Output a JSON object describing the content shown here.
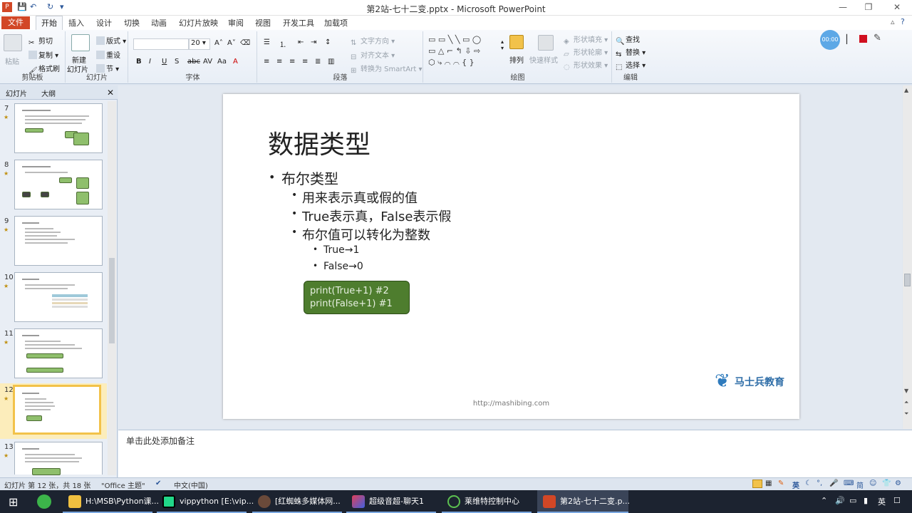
{
  "window": {
    "title": "第2站-七十二变.pptx - Microsoft PowerPoint",
    "controls": [
      "minimize",
      "restore",
      "close"
    ]
  },
  "tabs": {
    "file": "文件",
    "items": [
      "开始",
      "插入",
      "设计",
      "切换",
      "动画",
      "幻灯片放映",
      "审阅",
      "视图",
      "开发工具",
      "加载项"
    ]
  },
  "ribbon": {
    "clipboard": {
      "label": "剪贴板",
      "paste": "粘贴",
      "cut": "剪切",
      "copy": "复制",
      "format_painter": "格式刷"
    },
    "slides": {
      "label": "幻灯片",
      "new_slide_1": "新建",
      "new_slide_2": "幻灯片",
      "layout": "版式",
      "reset": "重设",
      "section": "节"
    },
    "font": {
      "label": "字体",
      "size": "20"
    },
    "paragraph": {
      "label": "段落",
      "text_direction": "文字方向",
      "align_text": "对齐文本",
      "smartart": "转换为 SmartArt"
    },
    "drawing": {
      "label": "绘图",
      "arrange": "排列",
      "quick_styles": "快速样式",
      "fill": "形状填充",
      "outline": "形状轮廓",
      "effects": "形状效果"
    },
    "editing": {
      "label": "编辑",
      "find": "查找",
      "replace": "替换",
      "select": "选择"
    }
  },
  "recorder": {
    "time": "00:00"
  },
  "left_pane": {
    "tabs": [
      "幻灯片",
      "大纲"
    ],
    "thumbnails": [
      {
        "num": "7"
      },
      {
        "num": "8"
      },
      {
        "num": "9"
      },
      {
        "num": "10"
      },
      {
        "num": "11"
      },
      {
        "num": "12"
      },
      {
        "num": "13"
      }
    ]
  },
  "slide": {
    "title": "数据类型",
    "bullet1": "布尔类型",
    "sub1": "用来表示真或假的值",
    "sub2": "True表示真，False表示假",
    "sub3": "布尔值可以转化为整数",
    "subsub1": "True→1",
    "subsub2": "False→0",
    "code_line1": "print(True+1) #2",
    "code_line2": "print(False+1) #1",
    "logo_text": "马士兵教育",
    "url": "http://mashibing.com"
  },
  "notes": {
    "placeholder": "单击此处添加备注"
  },
  "status": {
    "slide_info": "幻灯片 第 12 张，共 18 张",
    "theme": "\"Office 主题\"",
    "language": "中文(中国)"
  },
  "taskbar": {
    "items": [
      "H:\\MSB\\Python课...",
      "vippython [E:\\vip...",
      "[红蜘蛛多媒体网...",
      "超级音超-聊天1",
      "莱维特控制中心",
      "第2站-七十二变.p..."
    ],
    "ime": "英"
  }
}
